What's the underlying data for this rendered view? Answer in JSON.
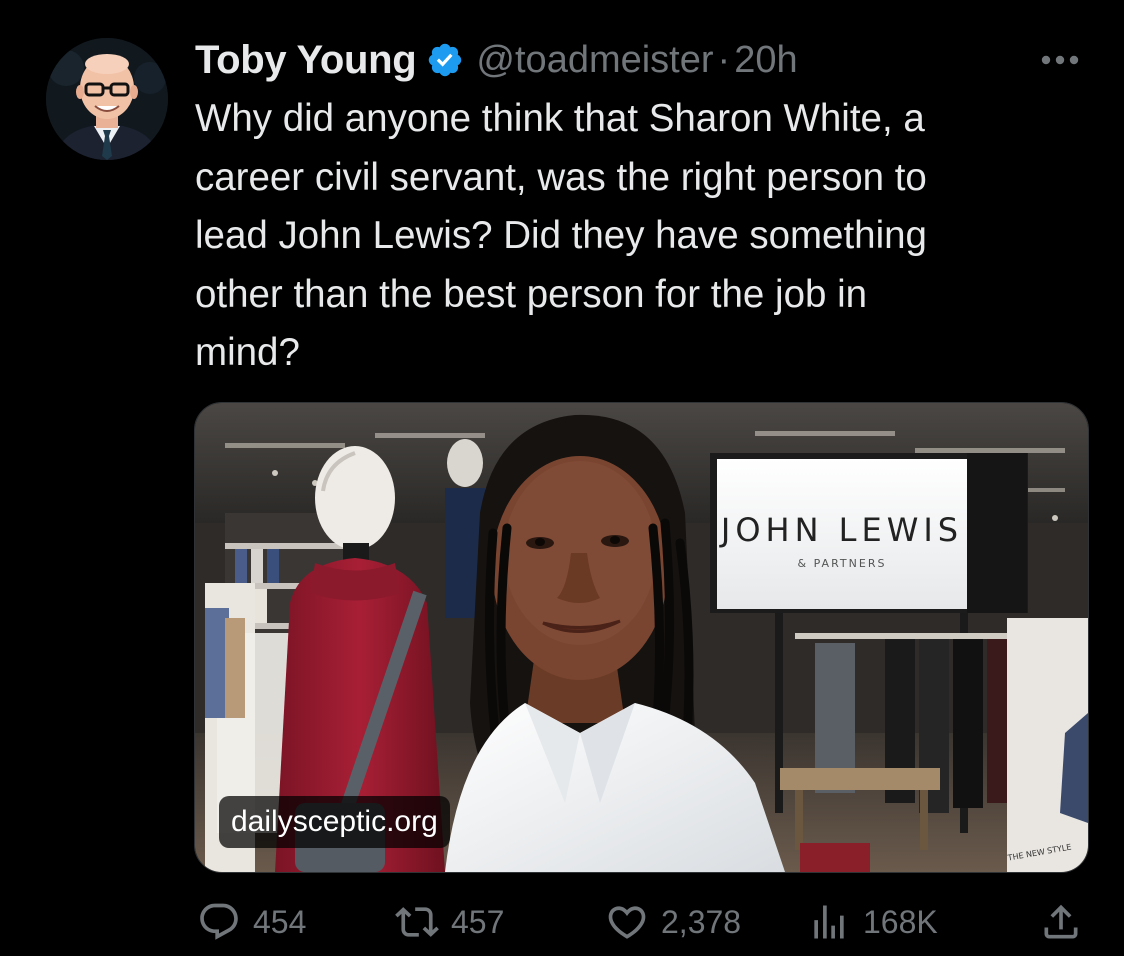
{
  "author": {
    "name": "Toby Young",
    "handle": "@toadmeister",
    "separator": "·",
    "time": "20h",
    "verified": true
  },
  "more_icon": "more-horizontal-icon",
  "tweet": {
    "text": "Why did anyone think that Sharon White, a\ncareer civil servant, was the right person to\nlead John Lewis? Did they have something\nother than the best person for the job in\nmind?"
  },
  "media": {
    "sign_title": "JOHN LEWIS",
    "sign_subtitle": "& PARTNERS",
    "small_sign": "THE NEW STYLE",
    "link_domain": "dailysceptic.org"
  },
  "actions": {
    "reply": {
      "icon": "reply-icon",
      "count": "454"
    },
    "retweet": {
      "icon": "retweet-icon",
      "count": "457"
    },
    "like": {
      "icon": "heart-icon",
      "count": "2,378"
    },
    "views": {
      "icon": "views-icon",
      "count": "168K"
    },
    "share": {
      "icon": "share-icon"
    }
  },
  "colors": {
    "background": "#000000",
    "text": "#e7e9ea",
    "secondary_text": "#71767b",
    "verified_badge": "#1d9bf0"
  }
}
